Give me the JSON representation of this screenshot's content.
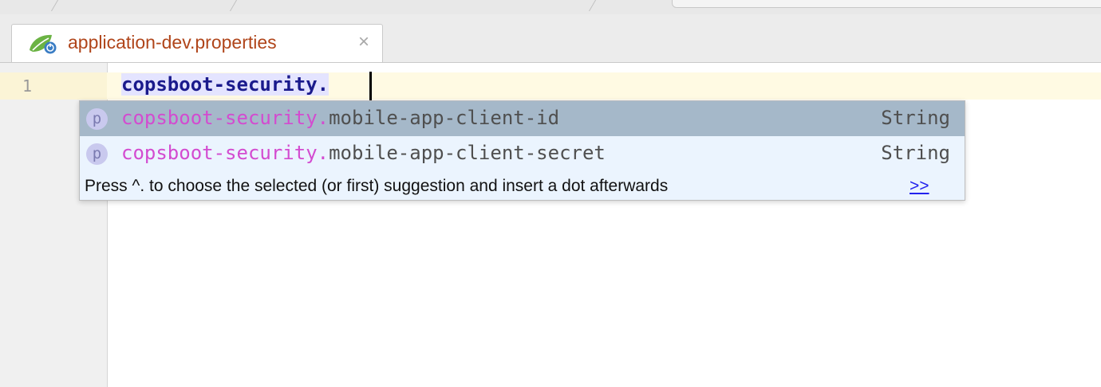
{
  "tab": {
    "label": "application-dev.properties",
    "close_glyph": "×",
    "icon": "spring-boot-icon"
  },
  "editor": {
    "line_number": "1",
    "code": "copsboot-security."
  },
  "completion": {
    "items": [
      {
        "badge": "p",
        "match": "copsboot-security.",
        "rest": "mobile-app-client-id",
        "type": "String",
        "selected": true
      },
      {
        "badge": "p",
        "match": "copsboot-security.",
        "rest": "mobile-app-client-secret",
        "type": "String",
        "selected": false
      }
    ],
    "hint": "Press ^. to choose the selected (or first) suggestion and insert a dot afterwards",
    "hint_link": ">>"
  },
  "colors": {
    "tab_label": "#b0451a",
    "match_highlight": "#d34bd0",
    "selected_row": "#a5b8c9",
    "popup_bg": "#ebf4fe",
    "link": "#2222ee"
  }
}
